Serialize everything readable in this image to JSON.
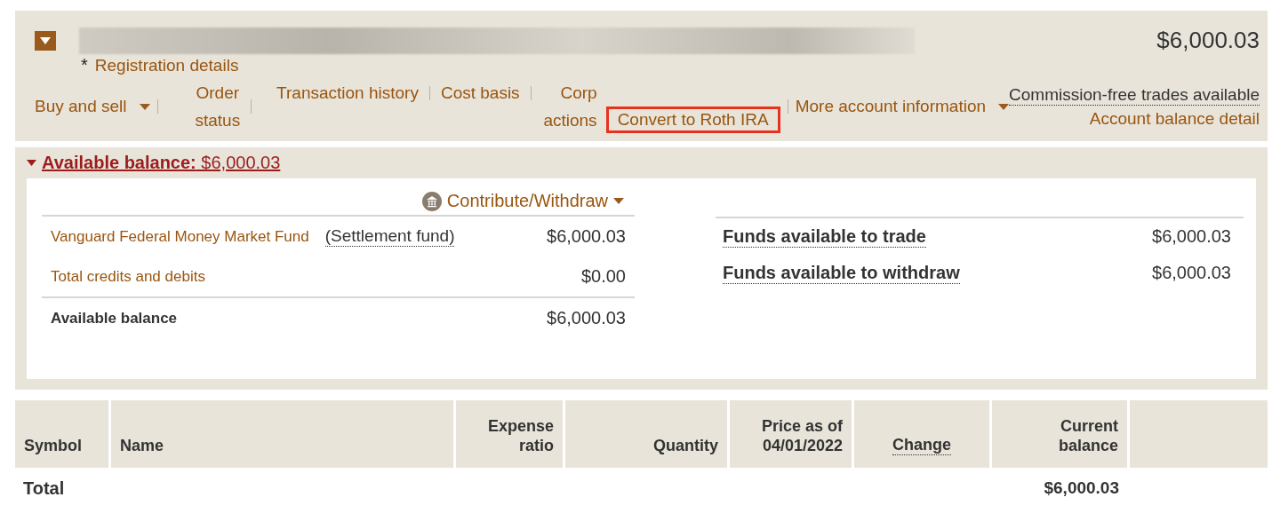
{
  "account": {
    "expanded": true,
    "asterisk": "*",
    "registration_link": "Registration details",
    "balance": "$6,000.03",
    "nav_left": [
      {
        "label": "Buy and sell",
        "kind": "dropdown"
      },
      {
        "label": "Order status",
        "kind": "link"
      }
    ],
    "nav_middle": [
      {
        "label": "Transaction history",
        "highlighted": false
      },
      {
        "label": "Cost basis",
        "highlighted": false
      },
      {
        "label": "Corp actions",
        "highlighted": false
      },
      {
        "label": "Convert to Roth IRA",
        "highlighted": true
      }
    ],
    "more_menu": "More account information",
    "commission_link": "Commission-free trades available",
    "balance_detail_link": "Account balance detail"
  },
  "available": {
    "expanded": true,
    "label": "Available balance:",
    "amount": "$6,000.03",
    "contribute_button": "Contribute/Withdraw",
    "rows": [
      {
        "kind": "fund",
        "label": "Vanguard Federal Money Market Fund",
        "note": "(Settlement fund)",
        "value": "$6,000.03"
      },
      {
        "kind": "link",
        "label": "Total credits and debits",
        "value": "$0.00"
      },
      {
        "kind": "total",
        "label": "Available balance",
        "value": "$6,000.03"
      }
    ],
    "funds": [
      {
        "label": "Funds available to trade",
        "value": "$6,000.03"
      },
      {
        "label": "Funds available to withdraw",
        "value": "$6,000.03"
      }
    ]
  },
  "holdings": {
    "columns": [
      {
        "label": "Symbol",
        "underlined": false
      },
      {
        "label": "Name",
        "underlined": false
      },
      {
        "label": "Expense ratio",
        "underlined": false
      },
      {
        "label": "Quantity",
        "underlined": false
      },
      {
        "label": "Price as of 04/01/2022",
        "underlined": false
      },
      {
        "label": "Change",
        "underlined": true
      },
      {
        "label": "Current balance",
        "underlined": false
      }
    ],
    "total_label": "Total",
    "total_value": "$6,000.03"
  }
}
